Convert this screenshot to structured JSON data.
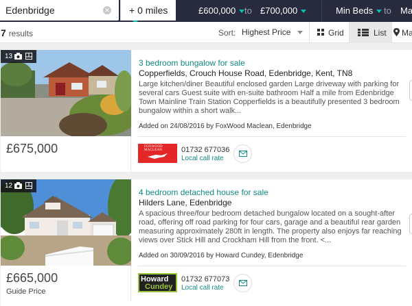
{
  "search": {
    "location": "Edenbridge",
    "radius": "+ 0 miles",
    "price_min": "£600,000",
    "price_to": "to",
    "price_max": "£700,000",
    "beds_min": "Min Beds",
    "beds_to": "to",
    "beds_max": "Max"
  },
  "toolbar": {
    "count": "7",
    "count_label": "results",
    "sort_label": "Sort:",
    "sort_value": "Highest Price",
    "grid_label": "Grid",
    "list_label": "List",
    "map_label": "Map"
  },
  "listings": [
    {
      "photo_count": "13",
      "title": "3 bedroom bungalow for sale",
      "address": "Copperfields, Crouch House Road, Edenbridge, Kent, TN8",
      "description": "Large kitchen/diner Beautiful enclosed garden Large driveway with parking for several cars Guest suite with en-suite bathroom Half a mile from Edenbridge Town Mainline Train Station Copperfields is a beautifully presented 3 bedroom bungalow within a short walk...",
      "added": "Added on 24/08/2016 by FoxWood Maclean, Edenbridge",
      "price": "£675,000",
      "price_qualifier": "",
      "agent_logo_text": "FOXWOOD MACLEAN",
      "phone": "01732 677036",
      "rate": "Local call rate"
    },
    {
      "photo_count": "12",
      "title": "4 bedroom detached house for sale",
      "address": "Hilders Lane, Edenbridge",
      "description": "A spacious three/four bedroom detached bungalow located on a sought-after road, offering off road parking for four cars, garage and a beautiful rear garden measuring approximately 280ft in length. The property also enjoys far reaching views over Stick Hill and Crockham Hill from the front. <...",
      "added": "Added on 30/09/2016 by Howard Cundey, Edenbridge",
      "price": "£665,000",
      "price_qualifier": "Guide Price",
      "agent_logo_text": [
        "Howard",
        "Cundey"
      ],
      "phone": "01732 677073",
      "rate": "Local call rate"
    }
  ],
  "colors": {
    "topbar": "#272b3d",
    "accent": "#00c1b2",
    "title_link": "#108a80",
    "foxwood_red": "#e32626",
    "howard_dark": "#222222",
    "howard_green": "#9bc23c"
  }
}
